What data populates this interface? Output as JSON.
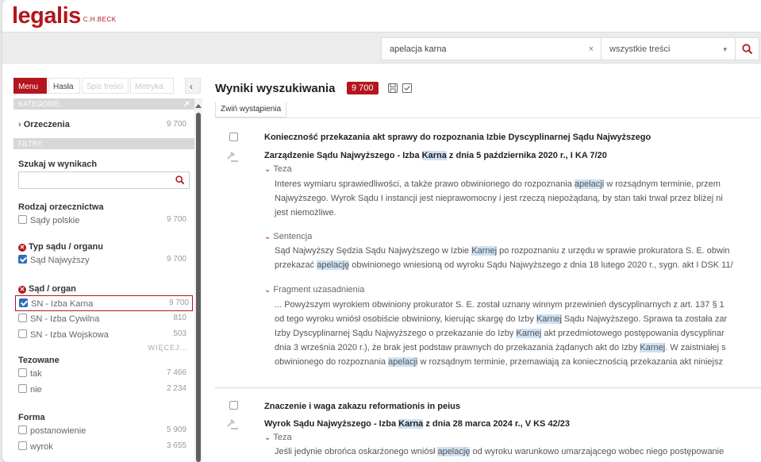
{
  "brand": {
    "logo": "legalis",
    "logo_sub": "C.H.BECK",
    "accent": "#b3161c",
    "highlight": "#cfe1f3"
  },
  "search": {
    "query": "apelacja karna",
    "clear": "×",
    "scope": "wszystkie treści",
    "scope_arrow": "▾"
  },
  "sidebar": {
    "tabs": [
      "Menu",
      "Hasła",
      "Spis treści",
      "Metryka"
    ],
    "collapse": "‹",
    "categories_label": "KATEGORIE:",
    "category": {
      "label": "Orzeczenia",
      "count": "9 700"
    },
    "filters_label": "FILTRY:",
    "search_in_results": "Szukaj w wynikach",
    "rodzaj": {
      "heading": "Rodzaj orzecznictwa",
      "options": [
        {
          "label": "Sądy polskie",
          "count": "9 700"
        }
      ]
    },
    "typ": {
      "heading": "Typ sądu / organu",
      "options": [
        {
          "label": "Sąd Najwyższy",
          "count": "9 700"
        }
      ]
    },
    "sad": {
      "heading": "Sąd / organ",
      "options": [
        {
          "label": "SN - Izba Karna",
          "count": "9 700"
        },
        {
          "label": "SN - Izba Cywilna",
          "count": "810"
        },
        {
          "label": "SN - Izba Wojskowa",
          "count": "503"
        }
      ],
      "more": "WIĘCEJ..."
    },
    "tezowane": {
      "heading": "Tezowane",
      "options": [
        {
          "label": "tak",
          "count": "7 466"
        },
        {
          "label": "nie",
          "count": "2 234"
        }
      ]
    },
    "forma": {
      "heading": "Forma",
      "options": [
        {
          "label": "postanowienie",
          "count": "5 909"
        },
        {
          "label": "wyrok",
          "count": "3 655"
        }
      ]
    }
  },
  "results": {
    "title": "Wyniki wyszukiwania",
    "count": "9 700",
    "collapse_all": "Zwiń wystąpienia",
    "items": [
      {
        "title": "Konieczność przekazania akt sprawy do rozpoznania Izbie Dyscyplinarnej Sądu Najwyższego",
        "sub_pre": "Zarządzenie Sądu Najwyższego - Izba ",
        "sub_hl": "Karna",
        "sub_post": " z dnia 5 października 2020 r., I KA 7/20",
        "teza_label": "Teza",
        "teza": [
          {
            "pre": "Interes wymiaru sprawiedliwości, a także prawo obwinionego do rozpoznania ",
            "hl": "apelacji",
            "post": " w rozsądnym terminie, przem"
          },
          {
            "pre": "Najwyższego. Wyrok Sądu I instancji jest nieprawomocny i jest rzeczą niepożądaną, by stan taki trwał przez bliżej ni",
            "hl": "",
            "post": ""
          },
          {
            "pre": "jest niemożliwe.",
            "hl": "",
            "post": ""
          }
        ],
        "sentencja_label": "Sentencja",
        "sentencja": [
          {
            "pre": "Sąd Najwyższy Sędzia Sądu Najwyższego w Izbie ",
            "hl": "Karnej",
            "post": " po rozpoznaniu z urzędu w sprawie prokuratora S. E. obwin"
          },
          {
            "pre": "przekazać ",
            "hl": "apelację",
            "post": " obwinionego wniesioną od wyroku Sądu Najwyższego z dnia 18 lutego 2020 r., sygn. akt I DSK 11/"
          }
        ],
        "fragment_label": "Fragment uzasadnienia",
        "fragment": [
          {
            "pre": "... Powyższym wyrokiem obwiniony prokurator S. E. został uznany winnym przewinień dyscyplinarnych z art. 137 § 1",
            "hl": "",
            "post": ""
          },
          {
            "pre": "od tego wyroku wniósł osobiście obwiniony, kierując skargę do Izby ",
            "hl": "Karnej",
            "post": " Sądu Najwyższego. Sprawa ta została zar"
          },
          {
            "pre": "Izby Dyscyplinarnej Sądu Najwyższego o przekazanie do Izby ",
            "hl": "Karnej",
            "post": " akt przedmiotowego postępowania dyscyplinar"
          },
          {
            "pre": "dnia 3 września 2020 r.), że brak jest podstaw prawnych do przekazania żądanych akt do Izby ",
            "hl": "Karnej",
            "post": ". W zaistniałej s"
          },
          {
            "pre": "obwinionego do rozpoznania ",
            "hl": "apelacji",
            "post": " w rozsądnym terminie, przemawiają za koniecznością przekazania akt niniejsz"
          }
        ]
      },
      {
        "title": "Znaczenie i waga zakazu reformationis in peius",
        "sub_pre": "Wyrok Sądu Najwyższego - Izba ",
        "sub_hl": "Karna",
        "sub_post": " z dnia 28 marca 2024 r., V KS 42/23",
        "teza_label": "Teza",
        "teza": [
          {
            "pre": "Jeśli jedynie obrońca oskarżonego wniósł ",
            "hl": "apelację",
            "post": " od wyroku warunkowo umarzającego wobec niego postępowanie"
          }
        ]
      }
    ]
  }
}
